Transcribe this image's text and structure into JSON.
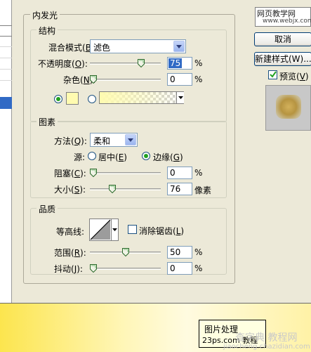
{
  "dialog": {
    "section_title": "内发光",
    "structure": {
      "title": "结构",
      "blend_mode_label": "混合模式",
      "blend_mode_key": "B",
      "blend_mode_value": "滤色",
      "opacity_label": "不透明度",
      "opacity_key": "O",
      "opacity_value": "75",
      "opacity_level": 0.75,
      "noise_label": "杂色",
      "noise_key": "N",
      "noise_value": "0",
      "noise_level": 0,
      "percent": "%"
    },
    "elements": {
      "title": "图素",
      "technique_label": "方法",
      "technique_key": "Q",
      "technique_value": "柔和",
      "source_label": "源",
      "source_center_label": "居中",
      "source_center_key": "E",
      "source_edge_label": "边缘",
      "source_edge_key": "G",
      "choke_label": "阻塞",
      "choke_key": "C",
      "choke_value": "0",
      "choke_level": 0,
      "size_label": "大小",
      "size_key": "S",
      "size_value": "76",
      "size_level": 0.3,
      "size_unit": "像素",
      "percent": "%"
    },
    "quality": {
      "title": "品质",
      "contour_label": "等高线",
      "antialias_label": "消除锯齿",
      "antialias_key": "L",
      "range_label": "范围",
      "range_key": "R",
      "range_value": "50",
      "range_level": 0.5,
      "jitter_label": "抖动",
      "jitter_key": "J",
      "jitter_value": "0",
      "jitter_level": 0,
      "percent": "%"
    },
    "glow_color": "#fffbb0"
  },
  "buttons": {
    "watermark_top": "网页教学网",
    "watermark_url": "www.webjx.com",
    "cancel": "取消",
    "new_style": "新建样式(W)...",
    "preview_label": "预览",
    "preview_key": "V"
  },
  "bottom": {
    "tip_line1": "图片处理",
    "tip_line2": "23ps.com 教程",
    "watermark_site": "查字典 教程网",
    "watermark_url": "jiaocheng.chazidian.com"
  }
}
